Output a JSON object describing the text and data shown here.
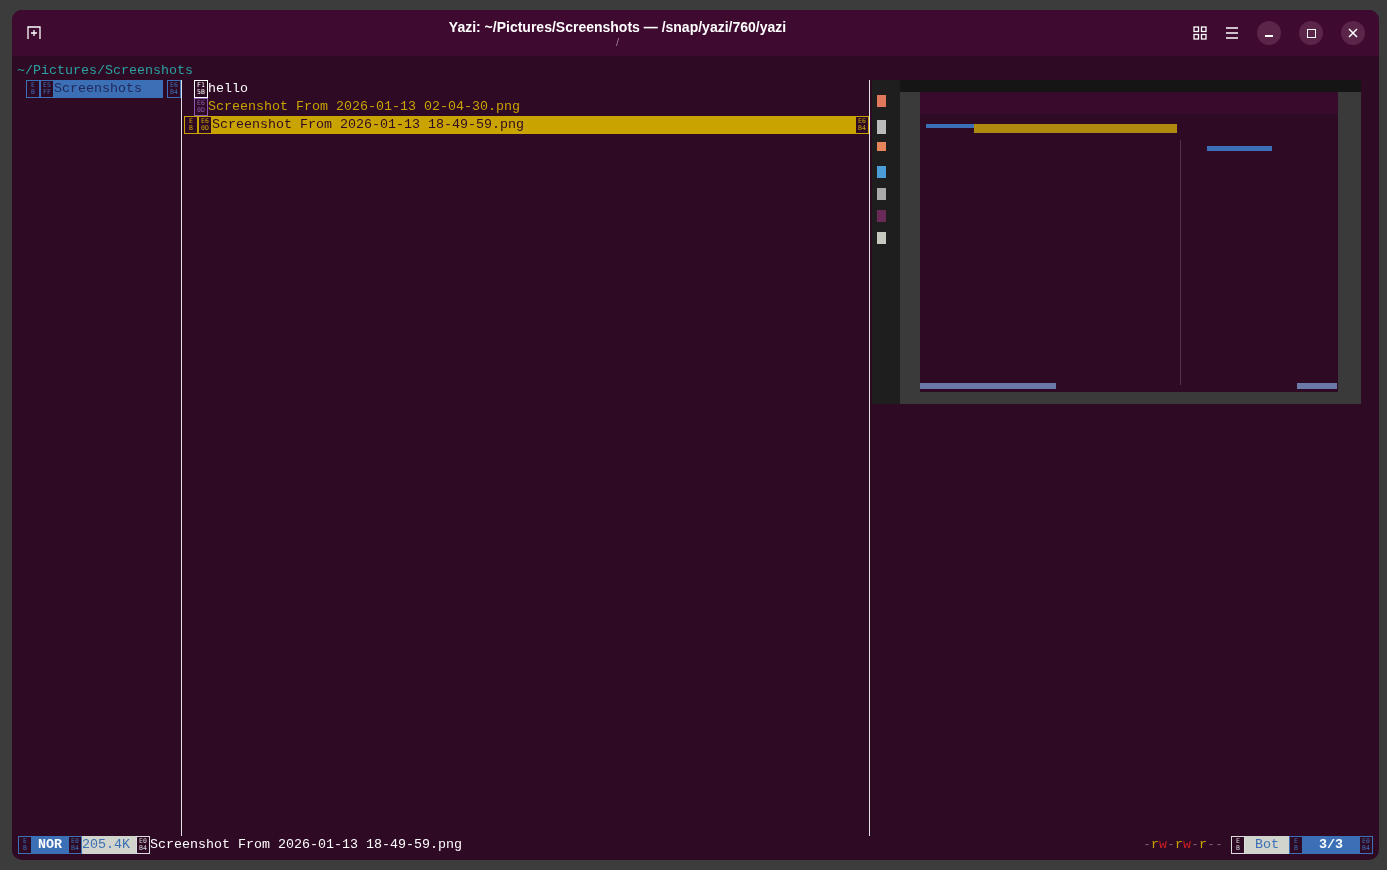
{
  "window": {
    "title": "Yazi: ~/Pictures/Screenshots — /snap/yazi/760/yazi",
    "subtitle": "/"
  },
  "path": "~/Pictures/Screenshots",
  "parent_column": [
    {
      "name": "Screenshots",
      "selected": true,
      "glyphs_left": [
        "EB",
        "E5FF"
      ],
      "glyph_right": "E6B4"
    }
  ],
  "current_column": [
    {
      "name": "hello",
      "kind": "folder",
      "selected": false,
      "glyphs_left": [
        "F15B"
      ]
    },
    {
      "name": "Screenshot From 2026-01-13 02-04-30.png",
      "selected": false,
      "glyphs_left": [
        "E60D"
      ]
    },
    {
      "name": "Screenshot From 2026-01-13 18-49-59.png",
      "selected": true,
      "glyphs_left": [
        "EB",
        "E60D"
      ],
      "glyph_right": "E6B4"
    }
  ],
  "status_bar": {
    "mode_glyph": "EB",
    "mode": "NOR",
    "size_glyph": "E0B4",
    "size": "205.4K",
    "file_glyph": "E0B4",
    "file": "Screenshot From 2026-01-13 18-49-59.png",
    "permissions": [
      {
        "text": "-",
        "kind": "none"
      },
      {
        "text": "r",
        "kind": "read"
      },
      {
        "text": "w",
        "kind": "write"
      },
      {
        "text": "-",
        "kind": "none"
      },
      {
        "text": "r",
        "kind": "read"
      },
      {
        "text": "w",
        "kind": "write"
      },
      {
        "text": "-",
        "kind": "none"
      },
      {
        "text": "r",
        "kind": "read"
      },
      {
        "text": "-",
        "kind": "none"
      },
      {
        "text": "-",
        "kind": "none"
      }
    ],
    "position_glyph": "EB",
    "position": "Bot",
    "count_glyph": "EB",
    "count": "3/3",
    "end_glyph": "E0B4"
  }
}
